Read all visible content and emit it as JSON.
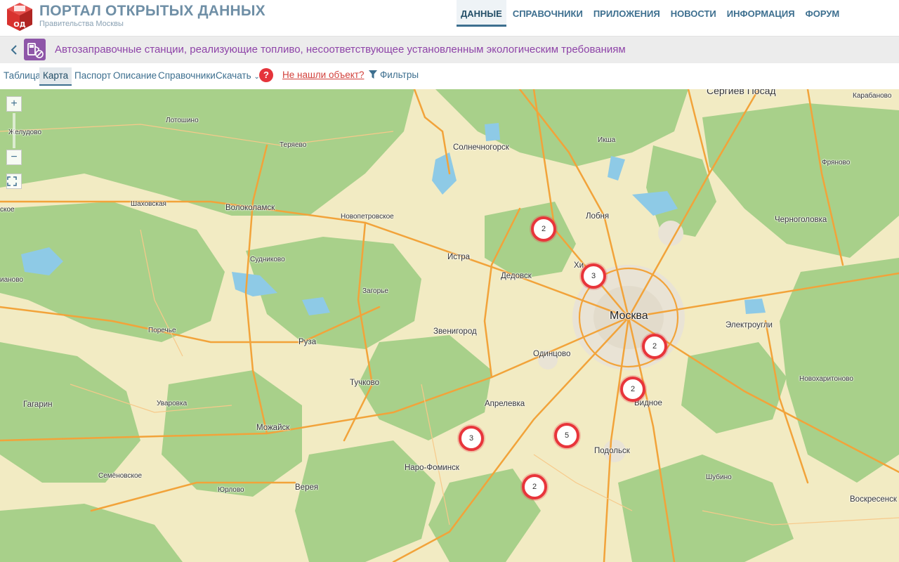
{
  "header": {
    "title": "ПОРТАЛ ОТКРЫТЫХ ДАННЫХ",
    "subtitle": "Правительства Москвы",
    "logo_text": "ОД",
    "nav": [
      "ДАННЫЕ",
      "СПРАВОЧНИКИ",
      "ПРИЛОЖЕНИЯ",
      "НОВОСТИ",
      "ИНФОРМАЦИЯ",
      "ФОРУМ"
    ],
    "nav_active": "ДАННЫЕ"
  },
  "dataset": {
    "back_icon": "chevron-left-icon",
    "icon": "fuel-pump-icon",
    "title": "Автозаправочные станции, реализующие топливо, несоответствующее установленным экологическим требованиям"
  },
  "tabs": {
    "table": "Таблица",
    "map": "Карта",
    "passport": "Паспорт",
    "description": "Описание",
    "references": "Справочники",
    "download": "Скачать",
    "help": "?",
    "not_found": "Не нашли объект?",
    "filters": "Фильтры",
    "active": "Карта"
  },
  "map": {
    "controls": {
      "zoom_in": "+",
      "zoom_out": "−"
    },
    "clusters": [
      {
        "id": "c1",
        "count": "2"
      },
      {
        "id": "c2",
        "count": "3"
      },
      {
        "id": "c3",
        "count": "2"
      },
      {
        "id": "c4",
        "count": "2"
      },
      {
        "id": "c5",
        "count": "5"
      },
      {
        "id": "c6",
        "count": "3"
      },
      {
        "id": "c7",
        "count": "2"
      }
    ],
    "places": {
      "sergiev_posad": "Сергиев Посад",
      "karabanovo": "Карабаново",
      "lotoshino": "Лотошино",
      "zheludovo": "Желудово",
      "teryaevo": "Теряево",
      "solnechnogorsk": "Солнечногорск",
      "iksha": "Икша",
      "fryanovo": "Фряново",
      "shakhovskaya": "Шаховская",
      "volokolamsk": "Волоколамск",
      "novopetrovskoe": "Новопетровское",
      "lobnya": "Лобня",
      "chernogolovka": "Черноголовка",
      "sudnikovo": "Судниково",
      "istra": "Истра",
      "khimki": "Хи",
      "dedovsk": "Дедовск",
      "zagorye": "Загорье",
      "moskva": "Москва",
      "elektrougli": "Электроугли",
      "porechye": "Поречье",
      "ruza": "Руза",
      "zvenigorod": "Звенигород",
      "odintsovo": "Одинцово",
      "tuchkovo": "Тучково",
      "novokharitonovo": "Новохаритоново",
      "gagarin": "Гагарин",
      "uvarovka": "Уваровка",
      "mozhaysk": "Можайск",
      "aprelevka": "Апрелевка",
      "vidnoe": "Видное",
      "naro_fominsk": "Наро-Фоминск",
      "podolsk": "Подольск",
      "semenovskoe": "Семёновское",
      "yurlovo": "Юрлово",
      "vereya": "Верея",
      "shubino": "Шубино",
      "voskresensk": "Воскресенск",
      "left_edge_1": "ское",
      "left_edge_2": "ианово"
    },
    "colors": {
      "forest": "#a8d08a",
      "field": "#f2ebc3",
      "water": "#8ecae6",
      "road": "#f2a33a",
      "urban": "#e9e3d5",
      "cluster_ring": "#e8353b"
    }
  }
}
